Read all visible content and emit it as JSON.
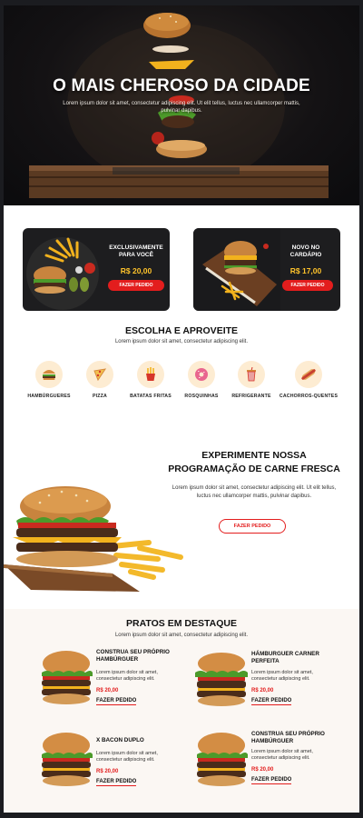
{
  "hero": {
    "title": "O MAIS CHEROSO DA CIDADE",
    "subtitle": "Lorem ipsum dolor sit amet, consectetur adipiscing elit. Ut elit tellus, luctus nec ullamcorper mattis, pulvinar dapibus."
  },
  "promos": [
    {
      "title": "EXCLUSIVAMENTE PARA VOCÊ",
      "price": "R$ 20,00",
      "button": "FAZER PEDIDO"
    },
    {
      "title": "NOVO NO CARDÁPIO",
      "price": "R$ 17,00",
      "button": "FAZER PEDIDO"
    }
  ],
  "categories_section": {
    "title": "ESCOLHA E APROVEITE",
    "subtitle": "Lorem ipsum dolor sit amet, consectetur adipiscing elit.",
    "items": [
      {
        "label": "HAMBÚRGUERES",
        "icon": "burger-icon"
      },
      {
        "label": "PIZZA",
        "icon": "pizza-icon"
      },
      {
        "label": "BATATAS FRITAS",
        "icon": "fries-icon"
      },
      {
        "label": "ROSQUINHAS",
        "icon": "donut-icon"
      },
      {
        "label": "REFRIGERANTE",
        "icon": "soda-icon"
      },
      {
        "label": "CACHORROS-QUENTES",
        "icon": "hotdog-icon"
      }
    ]
  },
  "feature": {
    "title": "EXPERIMENTE NOSSA PROGRAMAÇÃO DE CARNE FRESCA",
    "text": "Lorem ipsum dolor sit amet, consectetur adipiscing elit. Ut elit tellus, luctus nec ullamcorper mattis, pulvinar dapibus.",
    "button": "FAZER PEDIDO"
  },
  "dishes_section": {
    "title": "PRATOS EM DESTAQUE",
    "subtitle": "Lorem ipsum dolor sit amet, consectetur adipiscing elit.",
    "items": [
      {
        "name": "CONSTRUA SEU PRÓPRIO HAMBÚRGUER",
        "desc": "Lorem ipsum dolor sit amet, consectetur adipiscing elit.",
        "price": "R$ 20,00",
        "link": "FAZER PEDIDO"
      },
      {
        "name": "HÁMBURGUER CARNER PERFEITA",
        "desc": "Lorem ipsum dolor sit amet, consectetur adipiscing elit.",
        "price": "R$ 20,00",
        "link": "FAZER PEDIDO"
      },
      {
        "name": "X BACON DUPLO",
        "desc": "Lorem ipsum dolor sit amet, consectetur adipiscing elit.",
        "price": "R$ 20,00",
        "link": "FAZER PEDIDO"
      },
      {
        "name": "CONSTRUA SEU PRÓPRIO HAMBÚRGUER",
        "desc": "Lorem ipsum dolor sit amet, consectetur adipiscing elit.",
        "price": "R$ 20,00",
        "link": "FAZER PEDIDO"
      }
    ]
  },
  "colors": {
    "accent": "#e31d1d",
    "price_yellow": "#ffc32b",
    "category_bg": "#fdecd2",
    "dark": "#1d1d1f"
  }
}
